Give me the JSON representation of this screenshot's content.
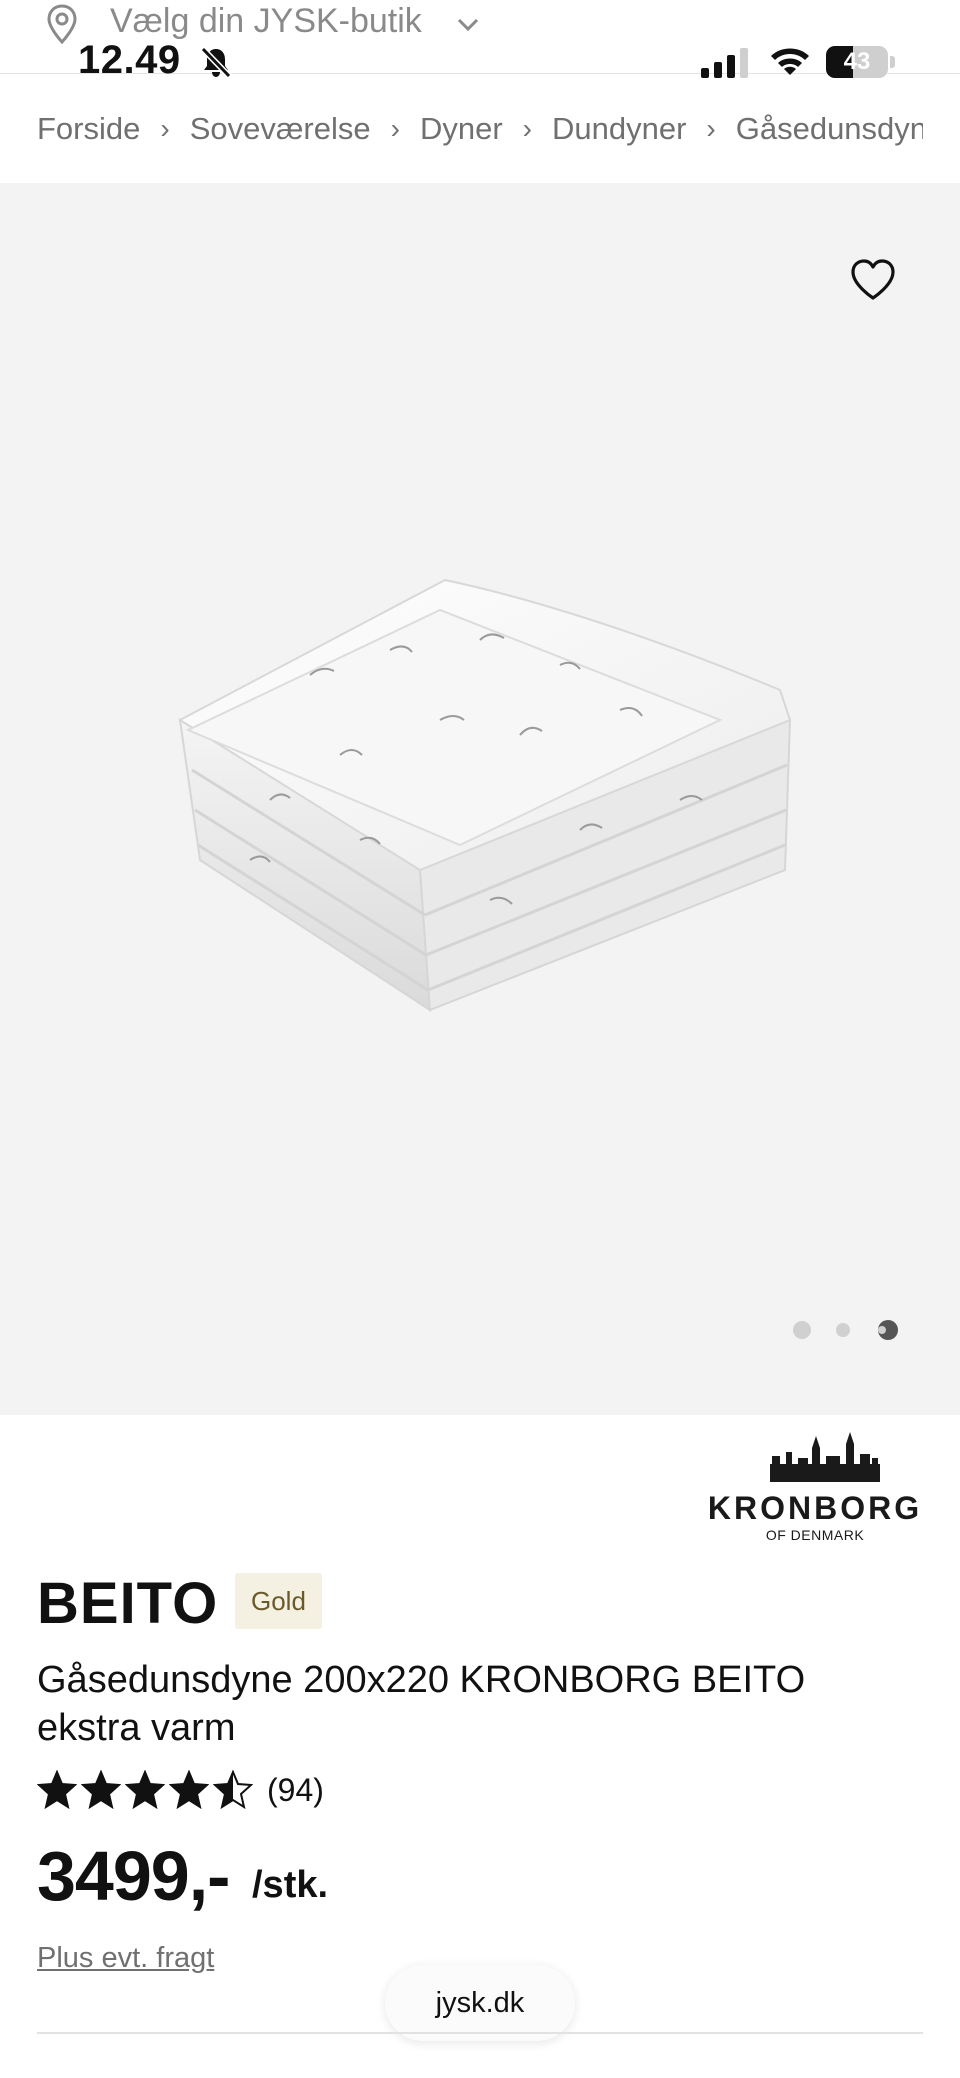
{
  "status_bar": {
    "time": "12.49",
    "battery_percent": "43",
    "battery_level": 0.43
  },
  "store_selector": {
    "label": "Vælg din JYSK-butik",
    "icon": "location-pin-icon"
  },
  "breadcrumb": [
    {
      "label": "Forside"
    },
    {
      "label": "Soveværelse"
    },
    {
      "label": "Dyner"
    },
    {
      "label": "Dundyner"
    },
    {
      "label": "Gåsedunsdyner"
    }
  ],
  "gallery": {
    "image_count": 4,
    "active_index": 0,
    "favorite_icon": "heart-outline-icon"
  },
  "brand": {
    "name": "KRONBORG",
    "tagline": "OF DENMARK"
  },
  "product": {
    "title": "BEITO",
    "badge": "Gold",
    "subtitle": "Gåsedunsdyne 200x220 KRONBORG BEITO ekstra varm",
    "rating": 4.5,
    "rating_max": 5,
    "review_count": "(94)",
    "price": "3499,-",
    "unit": "/stk.",
    "freight_link": "Plus evt. fragt"
  },
  "browser": {
    "url": "jysk.dk"
  },
  "colors": {
    "gallery_bg": "#f3f3f3",
    "badge_bg": "#f4f0e2",
    "badge_text": "#6a5a2a",
    "muted_text": "#707070"
  }
}
